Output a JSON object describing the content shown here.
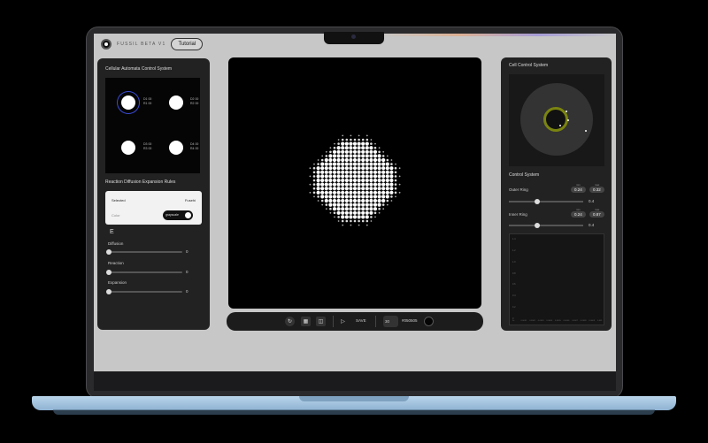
{
  "app": {
    "name": "FUSSIL BETA V1",
    "tutorial_label": "Tutorial"
  },
  "left_panel": {
    "title": "Cellular Automata Control System",
    "cells": [
      {
        "label_a": "D1 00",
        "label_b": "R1 00"
      },
      {
        "label_a": "D2 00",
        "label_b": "R2 00"
      },
      {
        "label_a": "D3 00",
        "label_b": "R3 00"
      },
      {
        "label_a": "D4 00",
        "label_b": "R4 00"
      }
    ],
    "rules_title": "Reaction Diffusion Expansion Rules",
    "selected_label": "Selected",
    "selected_value": "Fusehi",
    "color_label": "Color",
    "color_toggle_label": "grayscale",
    "e_label": "E",
    "sliders": [
      {
        "label": "Diffusion",
        "value": "0",
        "fraction": 0
      },
      {
        "label": "Reaction",
        "value": "0",
        "fraction": 0
      },
      {
        "label": "Expansion",
        "value": "0",
        "fraction": 0
      }
    ]
  },
  "right_panel": {
    "title": "Cell Control System",
    "control_title": "Control System",
    "outer_ring": {
      "label": "Outer Ring",
      "min_caption": "min",
      "max_caption": "max",
      "min": "0.24",
      "max": "0.32",
      "value": "0.4",
      "fraction": 0.38
    },
    "inner_ring": {
      "label": "Inner Ring",
      "min_caption": "min",
      "max_caption": "max",
      "min": "0.24",
      "max": "0.87",
      "value": "0.4",
      "fraction": 0.38
    },
    "graph": {
      "y_ticks": [
        "1.4",
        "1.2",
        "1.0",
        "0.8",
        "0.6",
        "0.4",
        "0.2",
        "0"
      ],
      "x_ticks": [
        "0s",
        "0.0001",
        "0.0002",
        "0.0003",
        "0.0004",
        "0.0005",
        "0.0006",
        "0.0007",
        "0.0008",
        "0.0009",
        "0.001"
      ]
    }
  },
  "toolbar": {
    "save_label": "SAVE",
    "size_value": "30",
    "color_hex": "#050505",
    "color_display": "#050505"
  },
  "colors": {
    "accent_ring": "#7a8410",
    "selection": "#3a4bd6"
  }
}
